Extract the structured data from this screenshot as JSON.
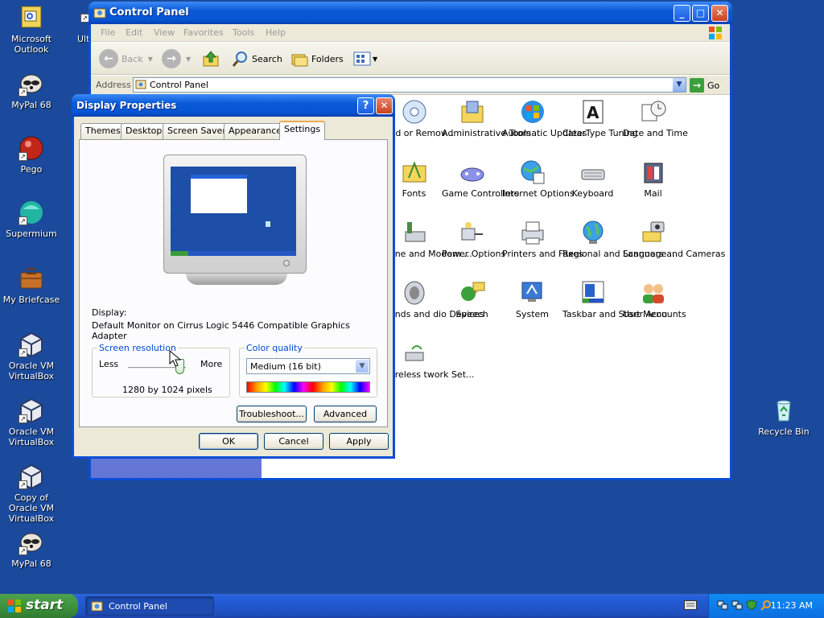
{
  "desktop": {
    "icons": [
      {
        "label": "Microsoft Outlook",
        "icon": "outlook-icon"
      },
      {
        "label": "MyPal 68",
        "icon": "raccoon-icon"
      },
      {
        "label": "Pego",
        "icon": "pego-icon"
      },
      {
        "label": "Supermium",
        "icon": "supermium-icon"
      },
      {
        "label": "My Briefcase",
        "icon": "briefcase-icon"
      },
      {
        "label": "Oracle VM VirtualBox",
        "icon": "virtualbox-icon"
      },
      {
        "label": "Oracle VM VirtualBox",
        "icon": "virtualbox-icon"
      },
      {
        "label": "Copy of Oracle VM VirtualBox",
        "icon": "virtualbox-icon"
      },
      {
        "label": "MyPal 68",
        "icon": "raccoon-icon"
      },
      {
        "label": "Ulti",
        "icon": "shortcut-icon"
      },
      {
        "label": "Recycle Bin",
        "icon": "recycle-bin-icon"
      }
    ]
  },
  "control_panel": {
    "title": "Control Panel",
    "menu": [
      "File",
      "Edit",
      "View",
      "Favorites",
      "Tools",
      "Help"
    ],
    "toolbar": {
      "back": "Back",
      "search": "Search",
      "folders": "Folders"
    },
    "address": {
      "label": "Address",
      "value": "Control Panel",
      "go": "Go"
    },
    "items": [
      {
        "label": "Add or Remov...",
        "icon": "add-remove-programs-icon"
      },
      {
        "label": "Administrative Tools",
        "icon": "administrative-tools-icon"
      },
      {
        "label": "Automatic Updates",
        "icon": "automatic-updates-icon"
      },
      {
        "label": "ClearType Tuning",
        "icon": "cleartype-icon"
      },
      {
        "label": "Date and Time",
        "icon": "date-time-icon"
      },
      {
        "label": "Fonts",
        "icon": "fonts-folder-icon"
      },
      {
        "label": "Game Controllers",
        "icon": "gamepad-icon"
      },
      {
        "label": "Internet Options",
        "icon": "internet-options-icon"
      },
      {
        "label": "Keyboard",
        "icon": "keyboard-icon"
      },
      {
        "label": "Mail",
        "icon": "mail-icon"
      },
      {
        "label": "hone and Modem ...",
        "icon": "phone-modem-icon"
      },
      {
        "label": "Power Options",
        "icon": "power-options-icon"
      },
      {
        "label": "Printers and Faxes",
        "icon": "printer-icon"
      },
      {
        "label": "Regional and Language ...",
        "icon": "globe-icon"
      },
      {
        "label": "Scanners and Cameras",
        "icon": "scanner-camera-icon"
      },
      {
        "label": "ounds and dio Devices",
        "icon": "speaker-icon"
      },
      {
        "label": "Speech",
        "icon": "speech-icon"
      },
      {
        "label": "System",
        "icon": "system-icon"
      },
      {
        "label": "Taskbar and Start Menu",
        "icon": "taskbar-icon"
      },
      {
        "label": "User Accounts",
        "icon": "users-icon"
      },
      {
        "label": "Wireless twork Set...",
        "icon": "wireless-icon"
      }
    ]
  },
  "display_properties": {
    "title": "Display Properties",
    "help_label": "?",
    "tabs": [
      "Themes",
      "Desktop",
      "Screen Saver",
      "Appearance",
      "Settings"
    ],
    "active_tab": "Settings",
    "display_label": "Display:",
    "display_value": "Default Monitor on Cirrus Logic 5446 Compatible Graphics Adapter",
    "screen_resolution": {
      "title": "Screen resolution",
      "less": "Less",
      "more": "More",
      "value": "1280 by 1024 pixels",
      "slider_position": 1.0
    },
    "color_quality": {
      "title": "Color quality",
      "selected": "Medium (16 bit)"
    },
    "buttons": {
      "troubleshoot": "Troubleshoot...",
      "advanced": "Advanced",
      "ok": "OK",
      "cancel": "Cancel",
      "apply": "Apply"
    }
  },
  "taskbar": {
    "start": "start",
    "tasks": [
      "Control Panel"
    ],
    "clock": "11:23 AM"
  },
  "colors": {
    "desktop": "#1b4a9c",
    "title_blue": "#0a5ad8",
    "start_green": "#3c8f3c",
    "tray_blue": "#0c6fe0"
  }
}
